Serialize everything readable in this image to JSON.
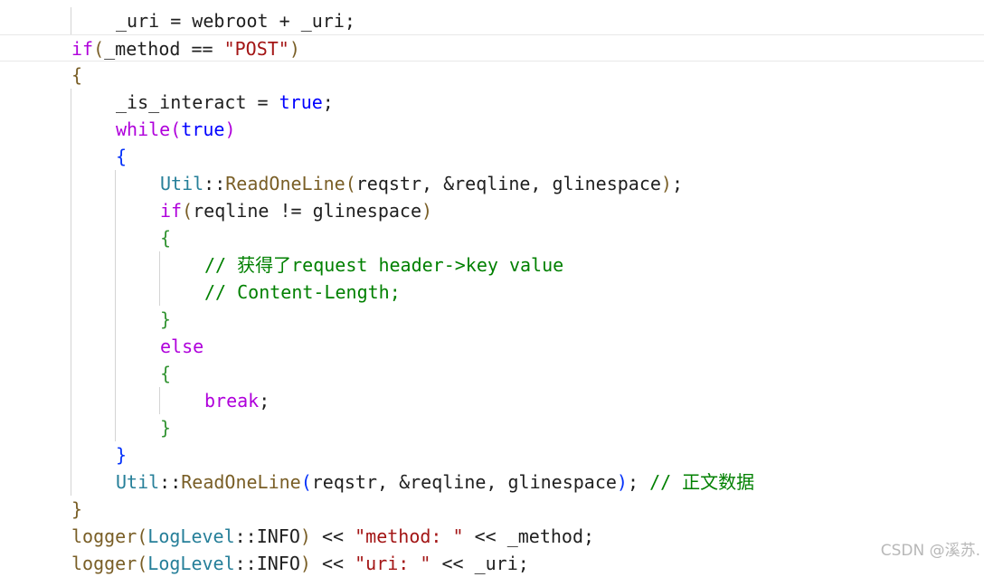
{
  "colors": {
    "keyword": "#af00db",
    "type_keyword": "#0000ff",
    "namespace": "#267f99",
    "function": "#795e26",
    "string": "#a31515",
    "comment": "#008000",
    "bracket_level1": "#795e26",
    "bracket_level2": "#af00db",
    "bracket_level3": "#0431fa",
    "bracket_level4": "#319331",
    "plain": "#1f1f1f",
    "guide": "#d4d4d4"
  },
  "code": {
    "lines": [
      {
        "indent": 2,
        "tokens": [
          {
            "t": "_uri = webroot + _uri;",
            "c": "plain"
          }
        ]
      },
      {
        "indent": 1,
        "tokens": [
          {
            "t": "if",
            "c": "keyword"
          },
          {
            "t": "(",
            "c": "bracket_level1"
          },
          {
            "t": "_method == ",
            "c": "plain"
          },
          {
            "t": "\"POST\"",
            "c": "string"
          },
          {
            "t": ")",
            "c": "bracket_level1"
          }
        ]
      },
      {
        "indent": 1,
        "tokens": [
          {
            "t": "{",
            "c": "bracket_level1"
          }
        ]
      },
      {
        "indent": 2,
        "tokens": [
          {
            "t": "_is_interact = ",
            "c": "plain"
          },
          {
            "t": "true",
            "c": "type_keyword"
          },
          {
            "t": ";",
            "c": "plain"
          }
        ]
      },
      {
        "indent": 2,
        "tokens": [
          {
            "t": "while",
            "c": "keyword"
          },
          {
            "t": "(",
            "c": "bracket_level2"
          },
          {
            "t": "true",
            "c": "type_keyword"
          },
          {
            "t": ")",
            "c": "bracket_level2"
          }
        ]
      },
      {
        "indent": 2,
        "tokens": [
          {
            "t": "{",
            "c": "bracket_level3"
          }
        ]
      },
      {
        "indent": 3,
        "tokens": [
          {
            "t": "Util",
            "c": "namespace"
          },
          {
            "t": "::",
            "c": "plain"
          },
          {
            "t": "ReadOneLine",
            "c": "function"
          },
          {
            "t": "(",
            "c": "bracket_level1"
          },
          {
            "t": "reqstr, &reqline, glinespace",
            "c": "plain"
          },
          {
            "t": ")",
            "c": "bracket_level1"
          },
          {
            "t": ";",
            "c": "plain"
          }
        ]
      },
      {
        "indent": 3,
        "tokens": [
          {
            "t": "if",
            "c": "keyword"
          },
          {
            "t": "(",
            "c": "bracket_level1"
          },
          {
            "t": "reqline != glinespace",
            "c": "plain"
          },
          {
            "t": ")",
            "c": "bracket_level1"
          }
        ]
      },
      {
        "indent": 3,
        "tokens": [
          {
            "t": "{",
            "c": "bracket_level4"
          }
        ]
      },
      {
        "indent": 4,
        "tokens": [
          {
            "t": "// 获得了request header->key value",
            "c": "comment"
          }
        ]
      },
      {
        "indent": 4,
        "tokens": [
          {
            "t": "// Content-Length;",
            "c": "comment"
          }
        ]
      },
      {
        "indent": 3,
        "tokens": [
          {
            "t": "}",
            "c": "bracket_level4"
          }
        ]
      },
      {
        "indent": 3,
        "tokens": [
          {
            "t": "else",
            "c": "keyword"
          }
        ]
      },
      {
        "indent": 3,
        "tokens": [
          {
            "t": "{",
            "c": "bracket_level4"
          }
        ]
      },
      {
        "indent": 4,
        "tokens": [
          {
            "t": "break",
            "c": "keyword"
          },
          {
            "t": ";",
            "c": "plain"
          }
        ]
      },
      {
        "indent": 3,
        "tokens": [
          {
            "t": "}",
            "c": "bracket_level4"
          }
        ]
      },
      {
        "indent": 2,
        "tokens": [
          {
            "t": "}",
            "c": "bracket_level3"
          }
        ]
      },
      {
        "indent": 2,
        "tokens": [
          {
            "t": "Util",
            "c": "namespace"
          },
          {
            "t": "::",
            "c": "plain"
          },
          {
            "t": "ReadOneLine",
            "c": "function"
          },
          {
            "t": "(",
            "c": "bracket_level3"
          },
          {
            "t": "reqstr, &reqline, glinespace",
            "c": "plain"
          },
          {
            "t": ")",
            "c": "bracket_level3"
          },
          {
            "t": "; ",
            "c": "plain"
          },
          {
            "t": "// 正文数据",
            "c": "comment"
          }
        ]
      },
      {
        "indent": 1,
        "tokens": [
          {
            "t": "}",
            "c": "bracket_level1"
          }
        ]
      },
      {
        "indent": 1,
        "tokens": [
          {
            "t": "logger",
            "c": "function"
          },
          {
            "t": "(",
            "c": "bracket_level1"
          },
          {
            "t": "LogLevel",
            "c": "namespace"
          },
          {
            "t": "::",
            "c": "plain"
          },
          {
            "t": "INFO",
            "c": "plain"
          },
          {
            "t": ")",
            "c": "bracket_level1"
          },
          {
            "t": " << ",
            "c": "plain"
          },
          {
            "t": "\"method: \"",
            "c": "string"
          },
          {
            "t": " << _method;",
            "c": "plain"
          }
        ]
      },
      {
        "indent": 1,
        "tokens": [
          {
            "t": "logger",
            "c": "function"
          },
          {
            "t": "(",
            "c": "bracket_level1"
          },
          {
            "t": "LogLevel",
            "c": "namespace"
          },
          {
            "t": "::",
            "c": "plain"
          },
          {
            "t": "INFO",
            "c": "plain"
          },
          {
            "t": ")",
            "c": "bracket_level1"
          },
          {
            "t": " << ",
            "c": "plain"
          },
          {
            "t": "\"uri: \"",
            "c": "string"
          },
          {
            "t": " << _uri;",
            "c": "plain"
          }
        ]
      }
    ],
    "current_line": 1
  },
  "watermark": "CSDN @溪苏."
}
